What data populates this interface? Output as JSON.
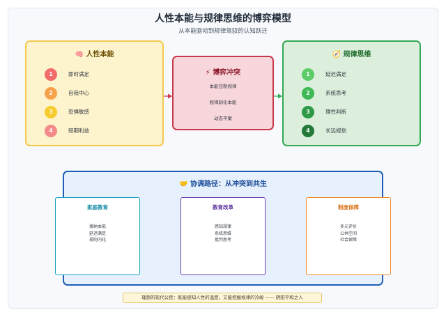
{
  "title": "人性本能与规律思维的博弈模型",
  "subtitle": "从本能驱动到规律驾驭的认知跃迁",
  "left_panel": {
    "icon": "brain-icon",
    "title": "🧠 人性本能",
    "items": [
      {
        "num": "1",
        "label": "即时满足",
        "color": "#f26b6b"
      },
      {
        "num": "2",
        "label": "自我中心",
        "color": "#f7a14a"
      },
      {
        "num": "3",
        "label": "恐惧敏感",
        "color": "#f7cc2f"
      },
      {
        "num": "4",
        "label": "短期利益",
        "color": "#f48a8a"
      }
    ]
  },
  "center_panel": {
    "title": "⚡ 博弈冲突",
    "lines": [
      "本能压制规律",
      "规律驯化本能",
      "动态平衡"
    ]
  },
  "right_panel": {
    "icon": "compass-icon",
    "title": "🧭 规律思维",
    "items": [
      {
        "num": "1",
        "label": "延迟满足",
        "color": "#5ccc6a"
      },
      {
        "num": "2",
        "label": "系统思考",
        "color": "#3fb856"
      },
      {
        "num": "3",
        "label": "理性判断",
        "color": "#2e9a45"
      },
      {
        "num": "4",
        "label": "长远规划",
        "color": "#237a36"
      }
    ]
  },
  "bottom_panel": {
    "title": "🤝 协调路径：从冲突到共生",
    "cards": [
      {
        "title": "家庭教育",
        "lines": [
          "接纳本能",
          "延迟满足",
          "规则内化"
        ]
      },
      {
        "title": "教育改革",
        "lines": [
          "感知规律",
          "系统思维",
          "批判思考"
        ]
      },
      {
        "title": "制度保障",
        "lines": [
          "多元评价",
          "公共空间",
          "社会保障"
        ]
      }
    ]
  },
  "footer": "理想的现代公民：既能感知人性的温度，又能把握规律的冷峻 —— 阴阳平和之人",
  "colors": {
    "arrow_left": "#c8384a",
    "arrow_right": "#34a853"
  }
}
